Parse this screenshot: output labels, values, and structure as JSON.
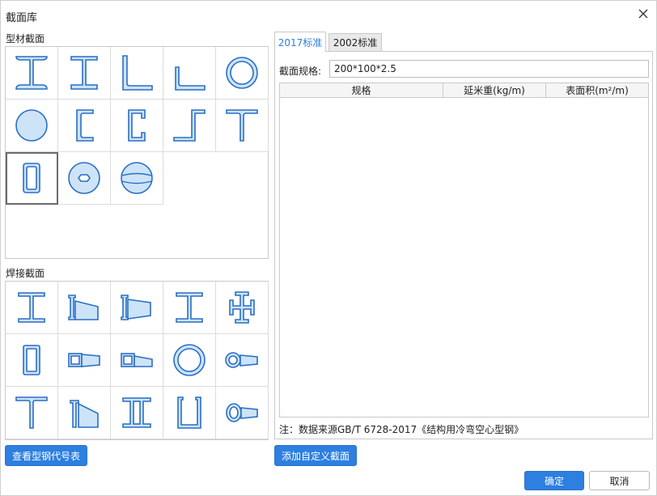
{
  "window": {
    "title": "截面库"
  },
  "left": {
    "profile_section_label": "型材截面",
    "welded_section_label": "焊接截面",
    "view_codes_button": "查看型钢代号表"
  },
  "right": {
    "tabs": [
      {
        "label": "2017标准",
        "active": true
      },
      {
        "label": "2002标准",
        "active": false
      }
    ],
    "spec_label": "截面规格:",
    "spec_value": "200*100*2.5",
    "table_headers": [
      "规格",
      "延米重(kg/m)",
      "表面积(m²/m)"
    ],
    "note": "注：数据来源GB/T 6728-2017《结构用冷弯空心型钢》",
    "add_custom_button": "添加自定义截面"
  },
  "footer": {
    "ok_button": "确定",
    "cancel_button": "取消"
  },
  "colors": {
    "accent": "#2d7fe0",
    "shape_fill": "#cde3f7",
    "shape_stroke": "#2a6fc4"
  },
  "profile_shapes": [
    "i-beam-icon",
    "h-beam-icon",
    "equal-angle-icon",
    "unequal-angle-icon",
    "circular-tube-icon",
    "round-bar-icon",
    "channel-icon",
    "lipped-channel-icon",
    "z-section-icon",
    "t-section-icon",
    "rectangular-tube-icon",
    "hexagon-nut-icon",
    "sphere-icon"
  ],
  "welded_shapes": [
    "welded-i-beam-icon",
    "tapered-i-beam-icon",
    "tapered-i-beam-2-icon",
    "welded-h-beam-icon",
    "cross-section-icon",
    "welded-box-icon",
    "box-tapered-icon",
    "box-tapered-2-icon",
    "welded-tube-icon",
    "tube-tapered-icon",
    "welded-t-icon",
    "tapered-t-icon",
    "double-i-icon",
    "u-section-icon",
    "ellipse-tapered-icon"
  ]
}
